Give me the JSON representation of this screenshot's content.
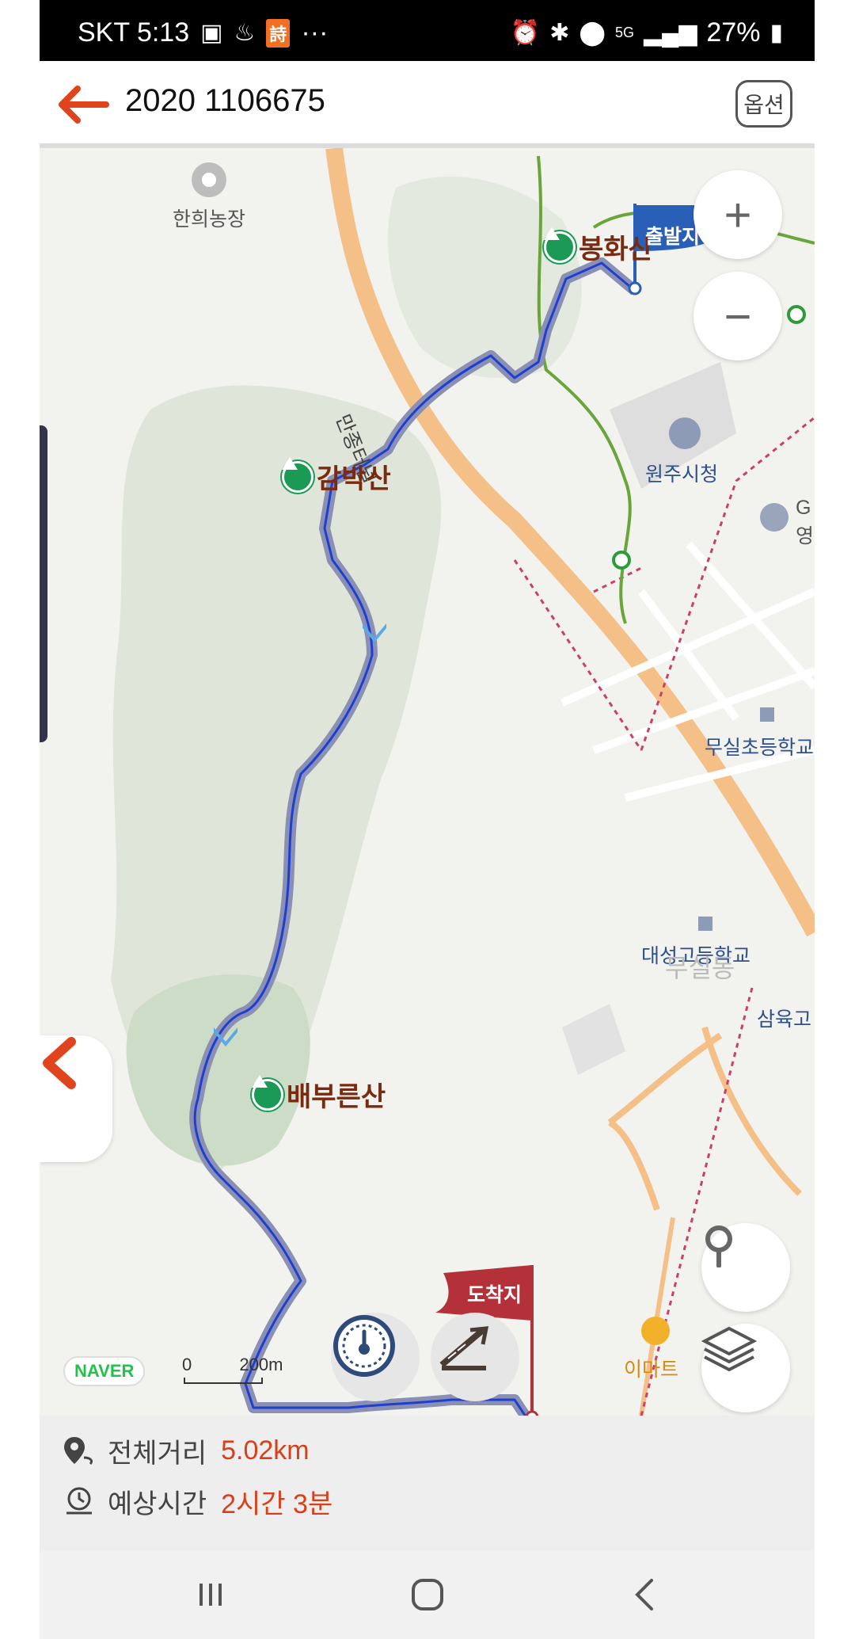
{
  "status_bar": {
    "carrier_time": "SKT 5:13",
    "badge": "詩",
    "more": "···",
    "net": "5G",
    "battery": "27%"
  },
  "header": {
    "title": "2020 1106675",
    "option_label": "옵션"
  },
  "map": {
    "labels": {
      "farm": "한희농장",
      "city_hall": "원주시청",
      "tunnel": "만종터널",
      "elementary": "무실초등학교",
      "high_school": "대성고등학교",
      "high_school_2": "삼육고",
      "emart": "이마트",
      "partial_g": "G",
      "partial_yeong": "영",
      "district": "무실동"
    },
    "mountains": {
      "bonghwa": "봉화산",
      "gambak": "감박산",
      "baeburuen": "배부른산"
    },
    "flags": {
      "start": "출발지",
      "end": "도착지"
    },
    "naver": "NAVER",
    "scale_zero": "0",
    "scale_dist": "200m"
  },
  "info": {
    "distance_label": "전체거리",
    "distance_value": "5.02km",
    "time_label": "예상시간",
    "time_value": "2시간 3분"
  },
  "colors": {
    "accent": "#e0441c",
    "route": "#1f3fd1",
    "mountain": "#1a9a55",
    "start_flag": "#2a5fb8",
    "end_flag": "#b5313a"
  }
}
